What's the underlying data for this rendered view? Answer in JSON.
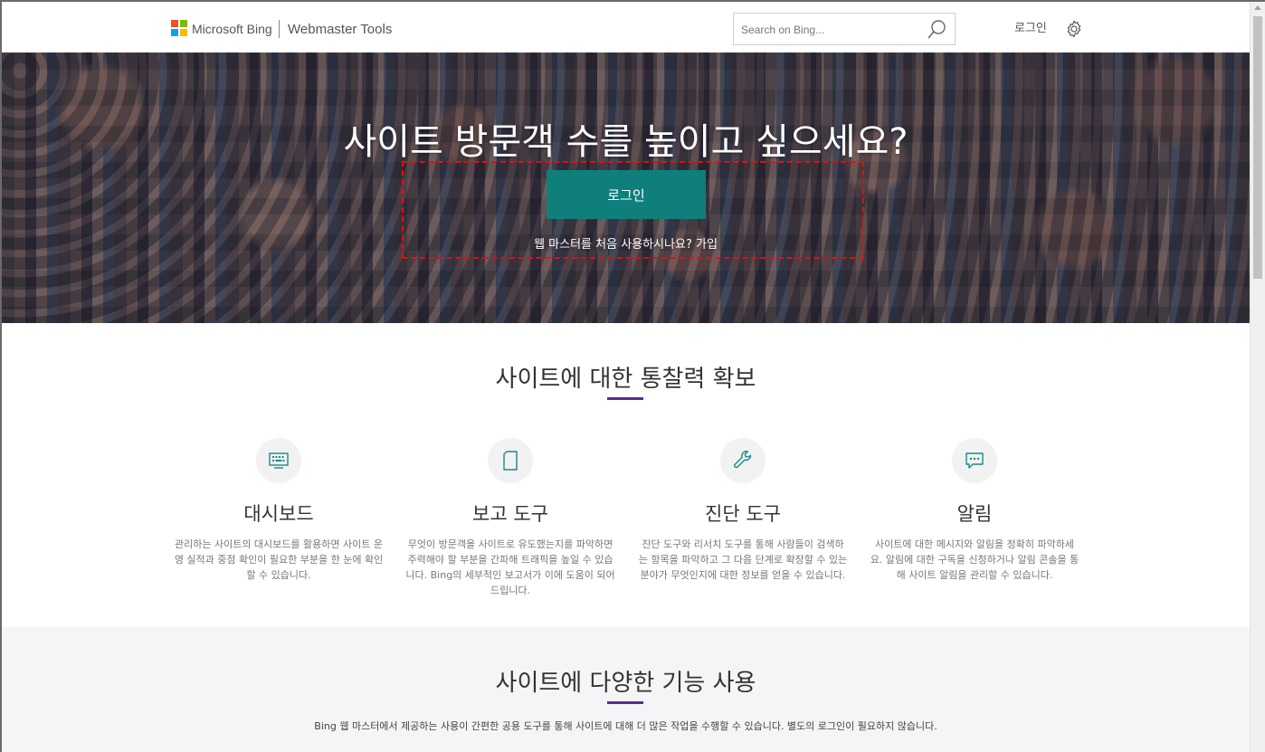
{
  "header": {
    "brand": "Microsoft Bing",
    "product": "Webmaster Tools",
    "search_placeholder": "Search on Bing...",
    "login_label": "로그인"
  },
  "hero": {
    "title": "사이트 방문객 수를 높이고 싶으세요?",
    "login_button": "로그인",
    "signup_text": "웹 마스터를 처음 사용하시나요?",
    "signup_link": "가입"
  },
  "insights": {
    "title": "사이트에 대한 통찰력 확보",
    "features": [
      {
        "icon": "keyboard-monitor-icon",
        "title": "대시보드",
        "description": "관리하는 사이트의 대시보드를 활용하면 사이트 운영 실적과 중점 확인이 필요한 부분을 한 눈에 확인할 수 있습니다."
      },
      {
        "icon": "document-icon",
        "title": "보고 도구",
        "description": "무엇이 방문객을 사이트로 유도했는지를 파악하면 주력해야 할 부분을 간파해 트래픽을 높일 수 있습니다. Bing의 세부적인 보고서가 이에 도움이 되어 드립니다."
      },
      {
        "icon": "wrench-icon",
        "title": "진단 도구",
        "description": "진단 도구와 리서치 도구를 통해 사람들이 검색하는 항목을 파악하고 그 다음 단계로 확장할 수 있는 분야가 무엇인지에 대한 정보를 얻을 수 있습니다."
      },
      {
        "icon": "chat-bubble-icon",
        "title": "알림",
        "description": "사이트에 대한 메시지와 알림을 정확히 파악하세요. 알림에 대한 구독을 신청하거나 알림 콘솔을 통해 사이트 알림을 관리할 수 있습니다."
      }
    ]
  },
  "features_section": {
    "title": "사이트에 다양한 기능 사용",
    "description": "Bing 웹 마스터에서 제공하는 사용이 간편한 공용 도구를 통해 사이트에 대해 더 많은 작업을 수행할 수 있습니다. 별도의 로그인이 필요하지 않습니다."
  },
  "colors": {
    "accent_teal": "#0f7f7c",
    "underline_purple": "#5b2b8c",
    "logo_red": "#f25022",
    "logo_green": "#7fba00",
    "logo_blue": "#00a4ef",
    "logo_yellow": "#ffb900",
    "icon_teal": "#1b8a8a"
  }
}
